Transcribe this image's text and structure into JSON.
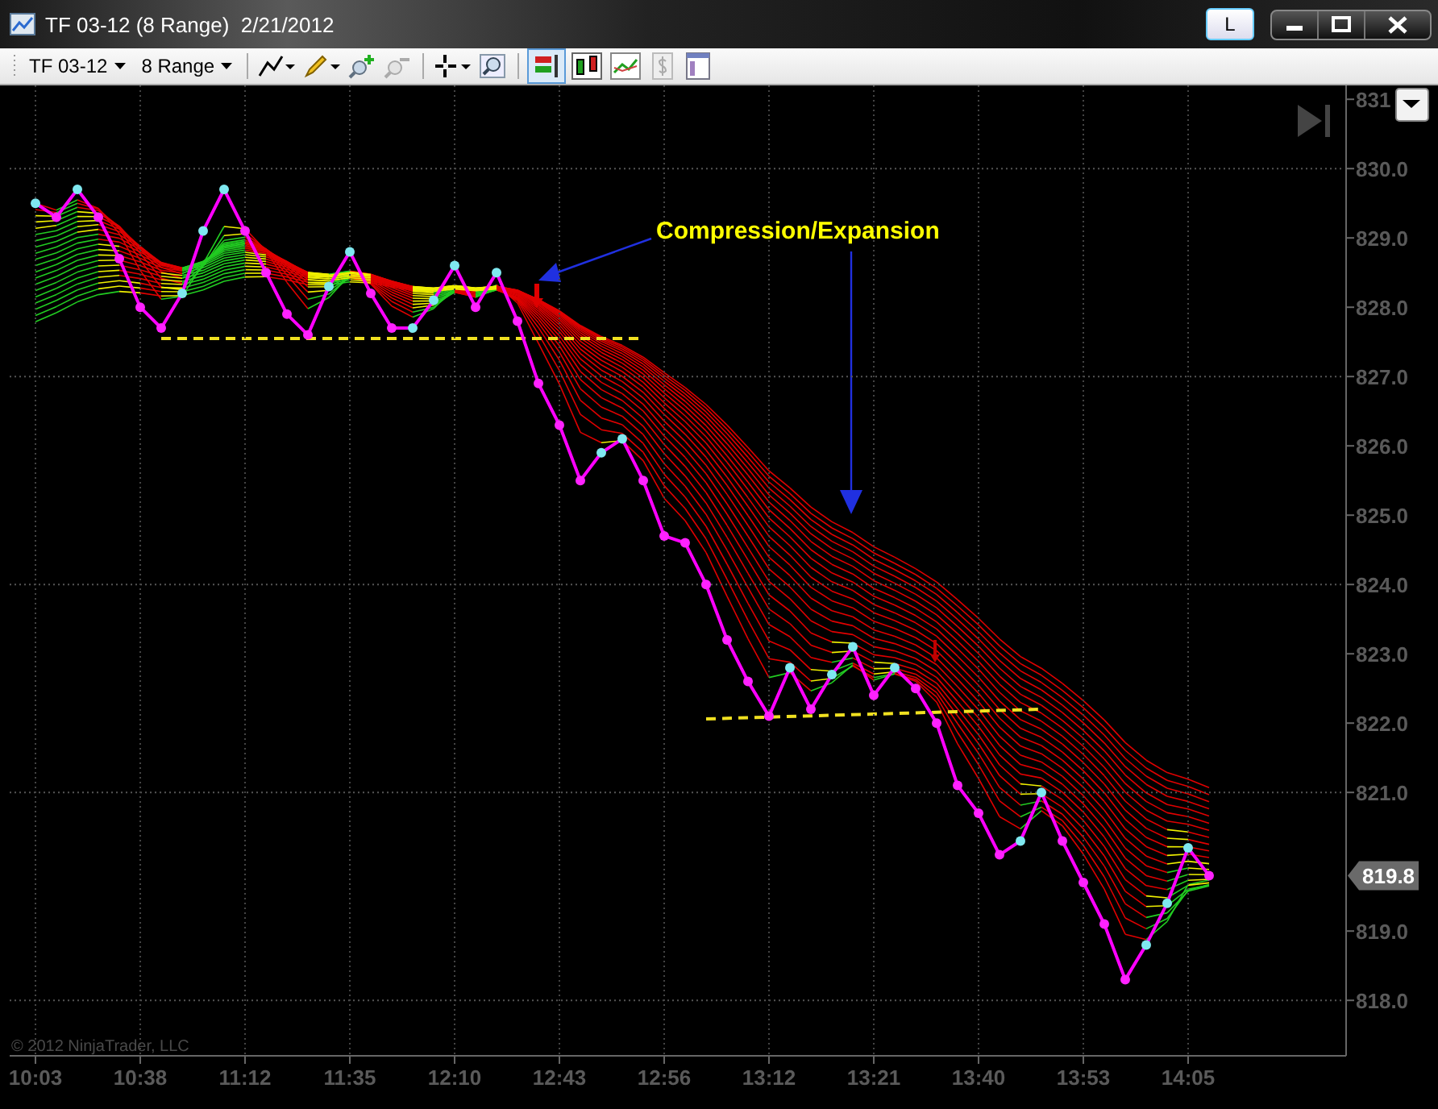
{
  "window": {
    "title": "TF 03-12 (8 Range)  2/21/2012",
    "layout_button": "L"
  },
  "toolbar": {
    "instrument": "TF 03-12",
    "period": "8 Range"
  },
  "chart": {
    "last_price": "819.8",
    "copyright": "© 2012 NinjaTrader, LLC",
    "chart_data": {
      "type": "line",
      "categories": [
        "10:03",
        null,
        null,
        null,
        null,
        "10:38",
        null,
        null,
        null,
        null,
        "11:12",
        null,
        null,
        null,
        null,
        "11:35",
        null,
        null,
        null,
        null,
        "12:10",
        null,
        null,
        null,
        null,
        "12:43",
        null,
        null,
        null,
        null,
        "12:56",
        null,
        null,
        null,
        null,
        "13:12",
        null,
        null,
        null,
        null,
        "13:21",
        null,
        null,
        null,
        null,
        "13:40",
        null,
        null,
        null,
        null,
        "13:53",
        null,
        null,
        null,
        null,
        "14:05",
        null
      ],
      "yticks": [
        {
          "value": 818,
          "label": "818.0"
        },
        {
          "value": 819,
          "label": "819.0"
        },
        {
          "value": 821,
          "label": "821.0"
        },
        {
          "value": 822,
          "label": "822.0"
        },
        {
          "value": 823,
          "label": "823.0"
        },
        {
          "value": 824,
          "label": "824.0"
        },
        {
          "value": 825,
          "label": "825.0"
        },
        {
          "value": 826,
          "label": "826.0"
        },
        {
          "value": 827,
          "label": "827.0"
        },
        {
          "value": 828,
          "label": "828.0"
        },
        {
          "value": 829,
          "label": "829.0"
        },
        {
          "value": 830,
          "label": "830.0"
        },
        {
          "value": 831,
          "label": "831"
        }
      ],
      "ylim": [
        817.2,
        831.2
      ],
      "grid": true,
      "series": [
        {
          "color": "#ff00ff",
          "marker": "o",
          "values": [
            829.5,
            829.3,
            829.7,
            829.3,
            828.7,
            828.0,
            827.7,
            828.2,
            829.1,
            829.7,
            829.1,
            828.5,
            827.9,
            827.6,
            828.3,
            828.8,
            828.2,
            827.7,
            827.7,
            828.1,
            828.6,
            828.0,
            828.5,
            827.8,
            826.9,
            826.3,
            825.5,
            825.9,
            826.1,
            825.5,
            824.7,
            824.6,
            824.0,
            823.2,
            822.6,
            822.1,
            822.8,
            822.2,
            822.7,
            823.1,
            822.4,
            822.8,
            822.5,
            822.0,
            821.1,
            820.7,
            820.1,
            820.3,
            821.0,
            820.3,
            819.7,
            819.1,
            818.3,
            818.8,
            819.4,
            820.2,
            819.8
          ]
        }
      ],
      "annotations": [
        {
          "text": "Compression/Expansion"
        }
      ]
    }
  }
}
